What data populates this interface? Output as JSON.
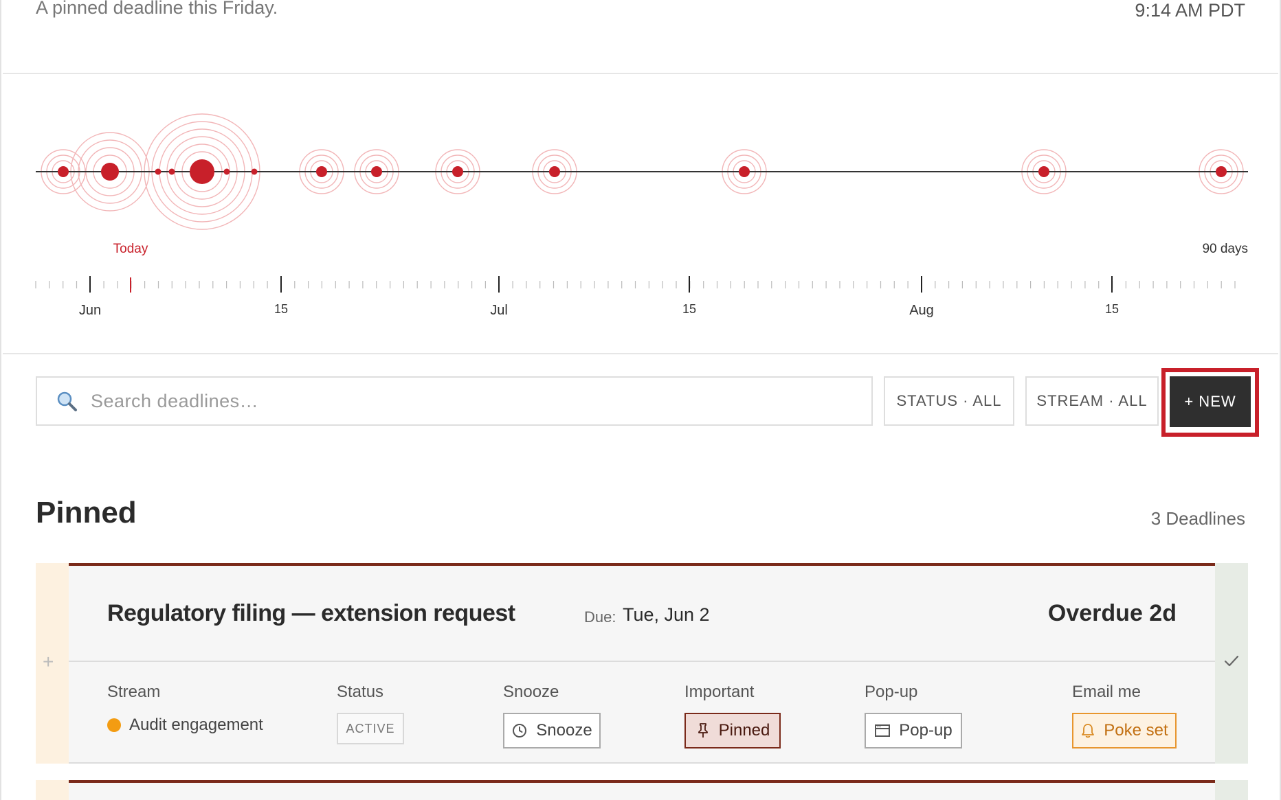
{
  "header": {
    "subtitle": "A pinned deadline this Friday.",
    "clock": "9:14 AM PDT"
  },
  "timeline": {
    "today_label": "Today",
    "range_label": "90 days",
    "month_labels": [
      "Jun",
      "Jul",
      "Aug"
    ],
    "mid_labels": [
      "15",
      "15",
      "15"
    ],
    "accent_color": "#c8202a"
  },
  "toolbar": {
    "search_placeholder": "Search deadlines…",
    "status_filter": "STATUS · ALL",
    "stream_filter": "STREAM · ALL",
    "new_label": "+ NEW",
    "search_icon": "search-icon"
  },
  "section": {
    "title": "Pinned",
    "count": "3 Deadlines"
  },
  "card": {
    "title": "Regulatory filing — extension request",
    "due_label": "Due:",
    "due_value": "Tue, Jun 2",
    "overdue": "Overdue 2d",
    "accent_color": "#7a2a1a",
    "fields": {
      "stream_label": "Stream",
      "stream_value": "Audit engagement",
      "stream_color": "#f39c12",
      "status_label": "Status",
      "status_value": "ACTIVE",
      "snooze_label": "Snooze",
      "snooze_button": "Snooze",
      "important_label": "Important",
      "important_button": "Pinned",
      "popup_label": "Pop-up",
      "popup_button": "Pop-up",
      "email_label": "Email me",
      "email_button": "Poke set"
    }
  }
}
